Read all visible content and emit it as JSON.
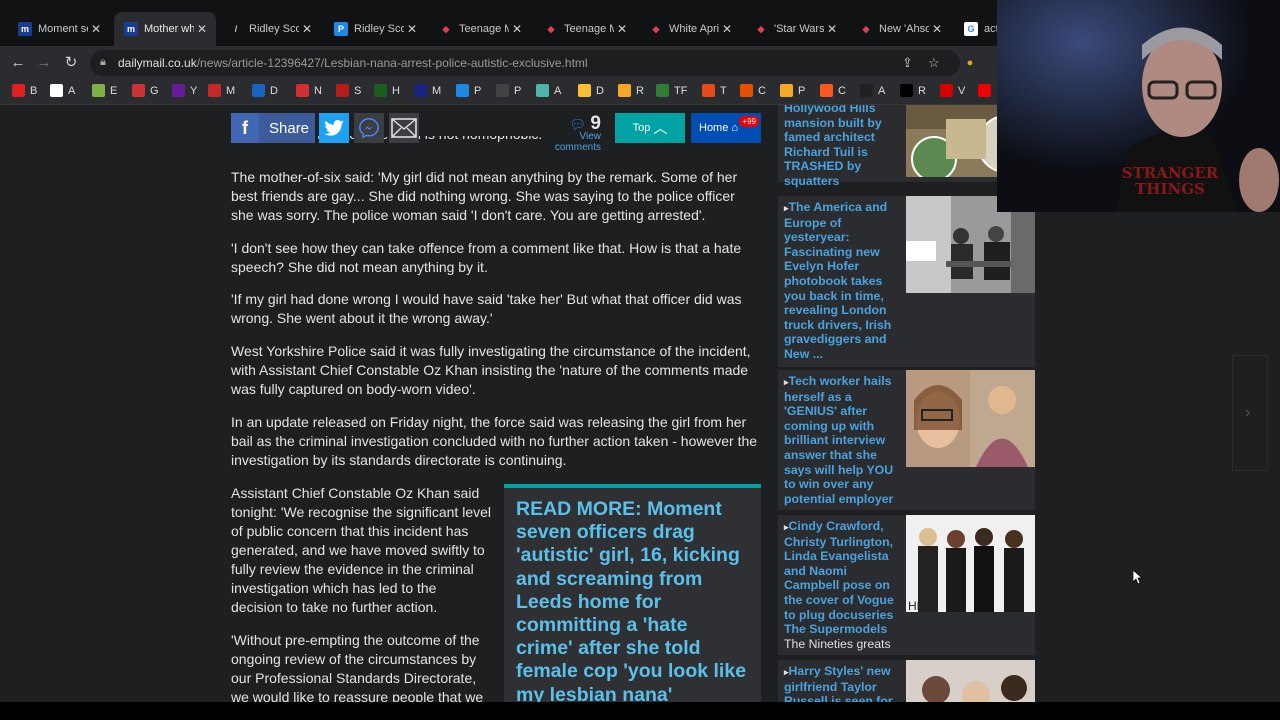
{
  "browser": {
    "tabs": [
      {
        "title": "Moment se",
        "fav": "m",
        "favbg": "#1a3d8f",
        "favfg": "#fff"
      },
      {
        "title": "Mother wh",
        "fav": "m",
        "favbg": "#1a3d8f",
        "favfg": "#fff"
      },
      {
        "title": "Ridley Scot",
        "fav": "/",
        "favbg": "#111214",
        "favfg": "#ccc"
      },
      {
        "title": "Ridley Scot",
        "fav": "P",
        "favbg": "#1e88e5",
        "favfg": "#fff"
      },
      {
        "title": "Teenage Mu",
        "fav": "◆",
        "favbg": "#111214",
        "favfg": "#e04050"
      },
      {
        "title": "Teenage Mu",
        "fav": "◆",
        "favbg": "#111214",
        "favfg": "#e04050"
      },
      {
        "title": "White April",
        "fav": "◆",
        "favbg": "#111214",
        "favfg": "#e04050"
      },
      {
        "title": "'Star Wars: A",
        "fav": "◆",
        "favbg": "#111214",
        "favfg": "#e04050"
      },
      {
        "title": "New 'Ahsok",
        "fav": "◆",
        "favbg": "#111214",
        "favfg": "#e04050"
      },
      {
        "title": "acto",
        "fav": "G",
        "favbg": "#ffffff",
        "favfg": "#4285f4"
      }
    ],
    "url_domain": "dailymail.co.uk",
    "url_path": "/news/article-12396427/Lesbian-nana-arrest-police-autistic-exclusive.html",
    "bookmarks": [
      {
        "label": "B",
        "color": "#e02020"
      },
      {
        "label": "A",
        "color": "#ffffff"
      },
      {
        "label": "E",
        "color": "#7cb342"
      },
      {
        "label": "G",
        "color": "#cc3333"
      },
      {
        "label": "Y",
        "color": "#6a1b9a"
      },
      {
        "label": "M",
        "color": "#c62828"
      },
      {
        "label": "D",
        "color": "#1565c0"
      },
      {
        "label": "N",
        "color": "#d32f2f"
      },
      {
        "label": "S",
        "color": "#b71c1c"
      },
      {
        "label": "H",
        "color": "#1b5e20"
      },
      {
        "label": "M",
        "color": "#1a237e"
      },
      {
        "label": "P",
        "color": "#1e88e5"
      },
      {
        "label": "P",
        "color": "#424242"
      },
      {
        "label": "A",
        "color": "#4db6ac"
      },
      {
        "label": "D",
        "color": "#fbc02d"
      },
      {
        "label": "R",
        "color": "#f9a825"
      },
      {
        "label": "TF",
        "color": "#2e7d32"
      },
      {
        "label": "T",
        "color": "#e64a19"
      },
      {
        "label": "C",
        "color": "#e65100"
      },
      {
        "label": "P",
        "color": "#f9a825"
      },
      {
        "label": "C",
        "color": "#ff5722"
      },
      {
        "label": "A",
        "color": "#212121"
      },
      {
        "label": "R",
        "color": "#000000"
      },
      {
        "label": "V",
        "color": "#d50000"
      }
    ]
  },
  "sharebar": {
    "share_label": "Share",
    "comments_count": "9",
    "comments_label": "View comments",
    "top_label": "Top",
    "home_label": "Home",
    "home_badge": "+99"
  },
  "article": {
    "cut_line": "daughter and insisted the child is not homophobic.",
    "paragraphs": [
      "The mother-of-six said: 'My girl did not mean anything by the remark. Some of her best friends are gay... She did nothing wrong. She was saying to the police officer she was sorry. The police woman said 'I don't care. You are getting arrested'.",
      "'I don't see how they can take offence from a comment like that. How is that a hate speech? She did not mean anything by it.",
      "'If my girl had done wrong I would have said 'take her' But what that officer did was wrong. She went about it the wrong away.'",
      "West Yorkshire Police said it was fully investigating the circumstance of the incident, with Assistant Chief Constable Oz Khan insisting the 'nature of the comments made was fully captured on body-worn video'.",
      "In an update released on Friday night, the force said was releasing the girl from her bail as the criminal investigation concluded with no further action taken - however the investigation by its standards directorate is continuing.",
      "Assistant Chief Constable Oz Khan said tonight: 'We recognise the significant level of public concern that this incident has generated, and we have moved swiftly to fully review the evidence in the criminal investigation which has led to the decision to take no further action.",
      "'Without pre-empting the outcome of the ongoing review of the circumstances by our Professional Standards Directorate, we would like to reassure people that we"
    ],
    "read_more_lead": "READ MORE:",
    "read_more_text": "Moment seven officers drag 'autistic' girl, 16, kicking and screaming from Leeds home for committing a 'hate crime' after she told female cop 'you look like my lesbian nana'"
  },
  "sidebar": [
    {
      "text": "Hollywood Hills mansion built by famed architect Richard Tuil is TRASHED by squatters",
      "sub": ""
    },
    {
      "text": "The America and Europe of yesteryear: Fascinating new Evelyn Hofer photobook takes you back in time, revealing London truck drivers, Irish gravediggers and New ...",
      "sub": ""
    },
    {
      "text": "Tech worker hails herself as a 'GENIUS' after coming up with brilliant interview answer that she says will help YOU to win over any potential employer",
      "sub": ""
    },
    {
      "text": "Cindy Crawford, Christy Turlington, Linda Evangelista and Naomi Campbell pose on the cover of Vogue to plug docuseries The Supermodels",
      "sub": "The Nineties greats"
    },
    {
      "text": "Harry Styles' new girlfriend Taylor Russell is seen for",
      "sub": ""
    }
  ],
  "webcam": {
    "shirt_text": "STRANGER THINGS"
  }
}
